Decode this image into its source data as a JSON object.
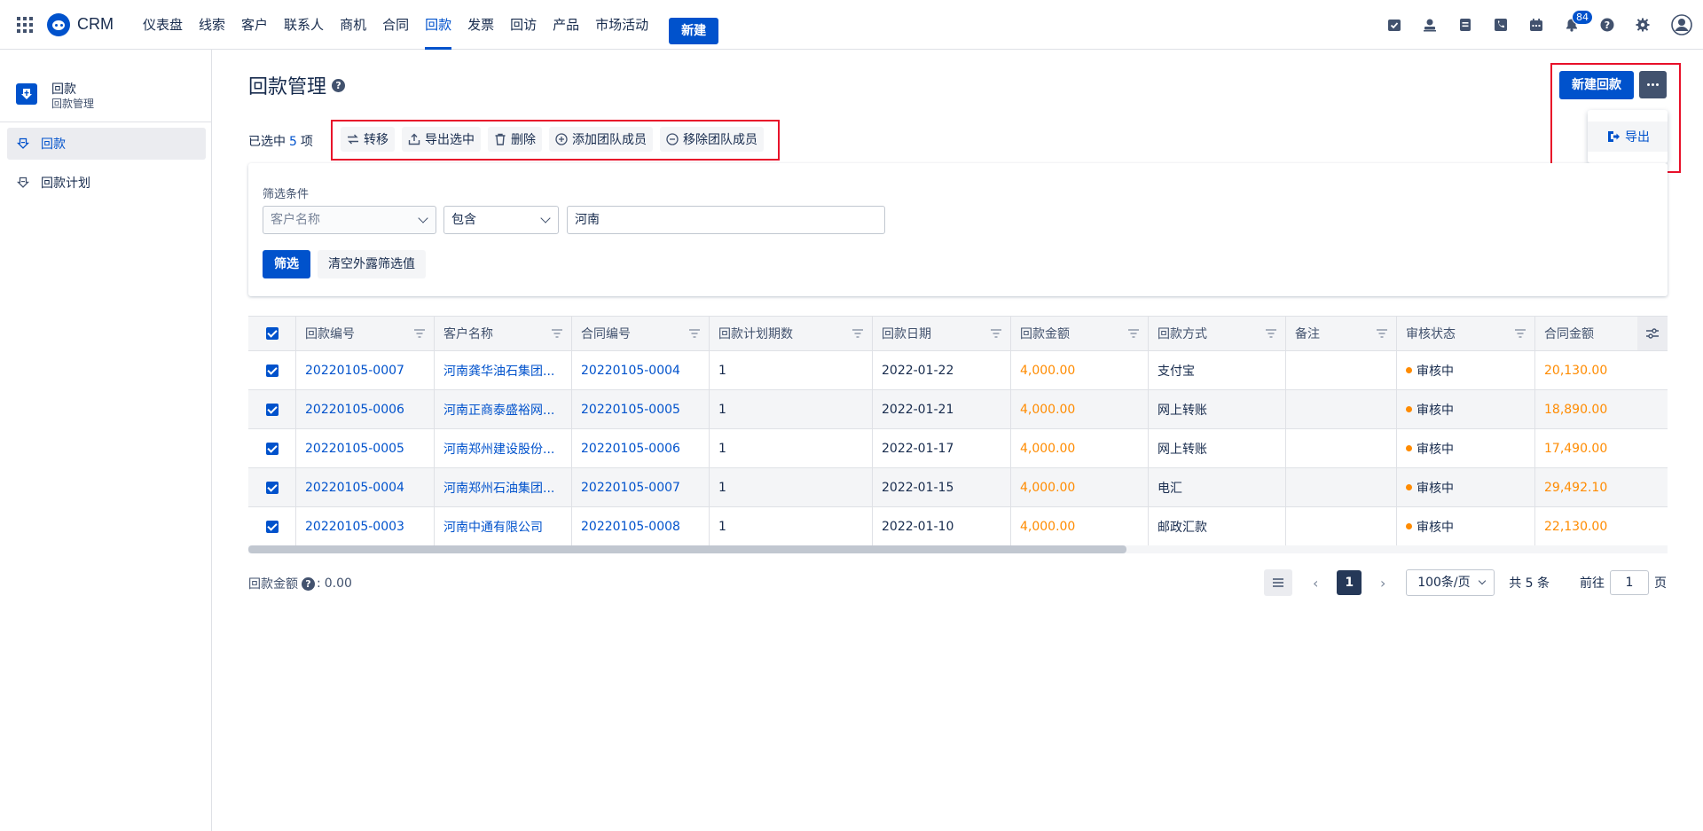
{
  "app": {
    "brand": "CRM"
  },
  "nav": {
    "items": [
      "仪表盘",
      "线索",
      "客户",
      "联系人",
      "商机",
      "合同",
      "回款",
      "发票",
      "回访",
      "产品",
      "市场活动"
    ],
    "active_index": 6,
    "new_label": "新建",
    "notification_count": "84"
  },
  "sidebar": {
    "title": "回款",
    "subtitle": "回款管理",
    "items": [
      {
        "label": "回款",
        "active": true
      },
      {
        "label": "回款计划",
        "active": false
      }
    ]
  },
  "page": {
    "title": "回款管理",
    "new_button": "新建回款",
    "more_menu": {
      "export_label": "导出"
    }
  },
  "selection": {
    "prefix": "已选中",
    "count": "5",
    "suffix": "项",
    "actions": [
      "转移",
      "导出选中",
      "删除",
      "添加团队成员",
      "移除团队成员"
    ]
  },
  "filter": {
    "label": "筛选条件",
    "field_placeholder": "客户名称",
    "operator": "包含",
    "value": "河南",
    "submit_label": "筛选",
    "clear_label": "清空外露筛选值"
  },
  "table": {
    "columns": [
      "回款编号",
      "客户名称",
      "合同编号",
      "回款计划期数",
      "回款日期",
      "回款金额",
      "回款方式",
      "备注",
      "审核状态",
      "合同金额"
    ],
    "rows": [
      {
        "no": "20220105-0007",
        "customer": "河南龚华油石集团...",
        "contract_no": "20220105-0004",
        "period": "1",
        "date": "2022-01-22",
        "amount": "4,000.00",
        "method": "支付宝",
        "remark": "",
        "status": "审核中",
        "contract_amount": "20,130.00"
      },
      {
        "no": "20220105-0006",
        "customer": "河南正商泰盛裕网...",
        "contract_no": "20220105-0005",
        "period": "1",
        "date": "2022-01-21",
        "amount": "4,000.00",
        "method": "网上转账",
        "remark": "",
        "status": "审核中",
        "contract_amount": "18,890.00"
      },
      {
        "no": "20220105-0005",
        "customer": "河南郑州建设股份...",
        "contract_no": "20220105-0006",
        "period": "1",
        "date": "2022-01-17",
        "amount": "4,000.00",
        "method": "网上转账",
        "remark": "",
        "status": "审核中",
        "contract_amount": "17,490.00"
      },
      {
        "no": "20220105-0004",
        "customer": "河南郑州石油集团...",
        "contract_no": "20220105-0007",
        "period": "1",
        "date": "2022-01-15",
        "amount": "4,000.00",
        "method": "电汇",
        "remark": "",
        "status": "审核中",
        "contract_amount": "29,492.10"
      },
      {
        "no": "20220105-0003",
        "customer": "河南中通有限公司",
        "contract_no": "20220105-0008",
        "period": "1",
        "date": "2022-01-10",
        "amount": "4,000.00",
        "method": "邮政汇款",
        "remark": "",
        "status": "审核中",
        "contract_amount": "22,130.00"
      }
    ]
  },
  "summary": {
    "label": "回款金额",
    "colon": ":",
    "value": "0.00"
  },
  "pagination": {
    "current_page": "1",
    "page_size": "100条/页",
    "total": "共 5 条",
    "goto_prefix": "前往",
    "goto_value": "1",
    "goto_suffix": "页"
  },
  "colors": {
    "primary": "#0052cc",
    "text": "#172b4d",
    "money": "#ff8b00",
    "highlight": "#e8102a"
  }
}
